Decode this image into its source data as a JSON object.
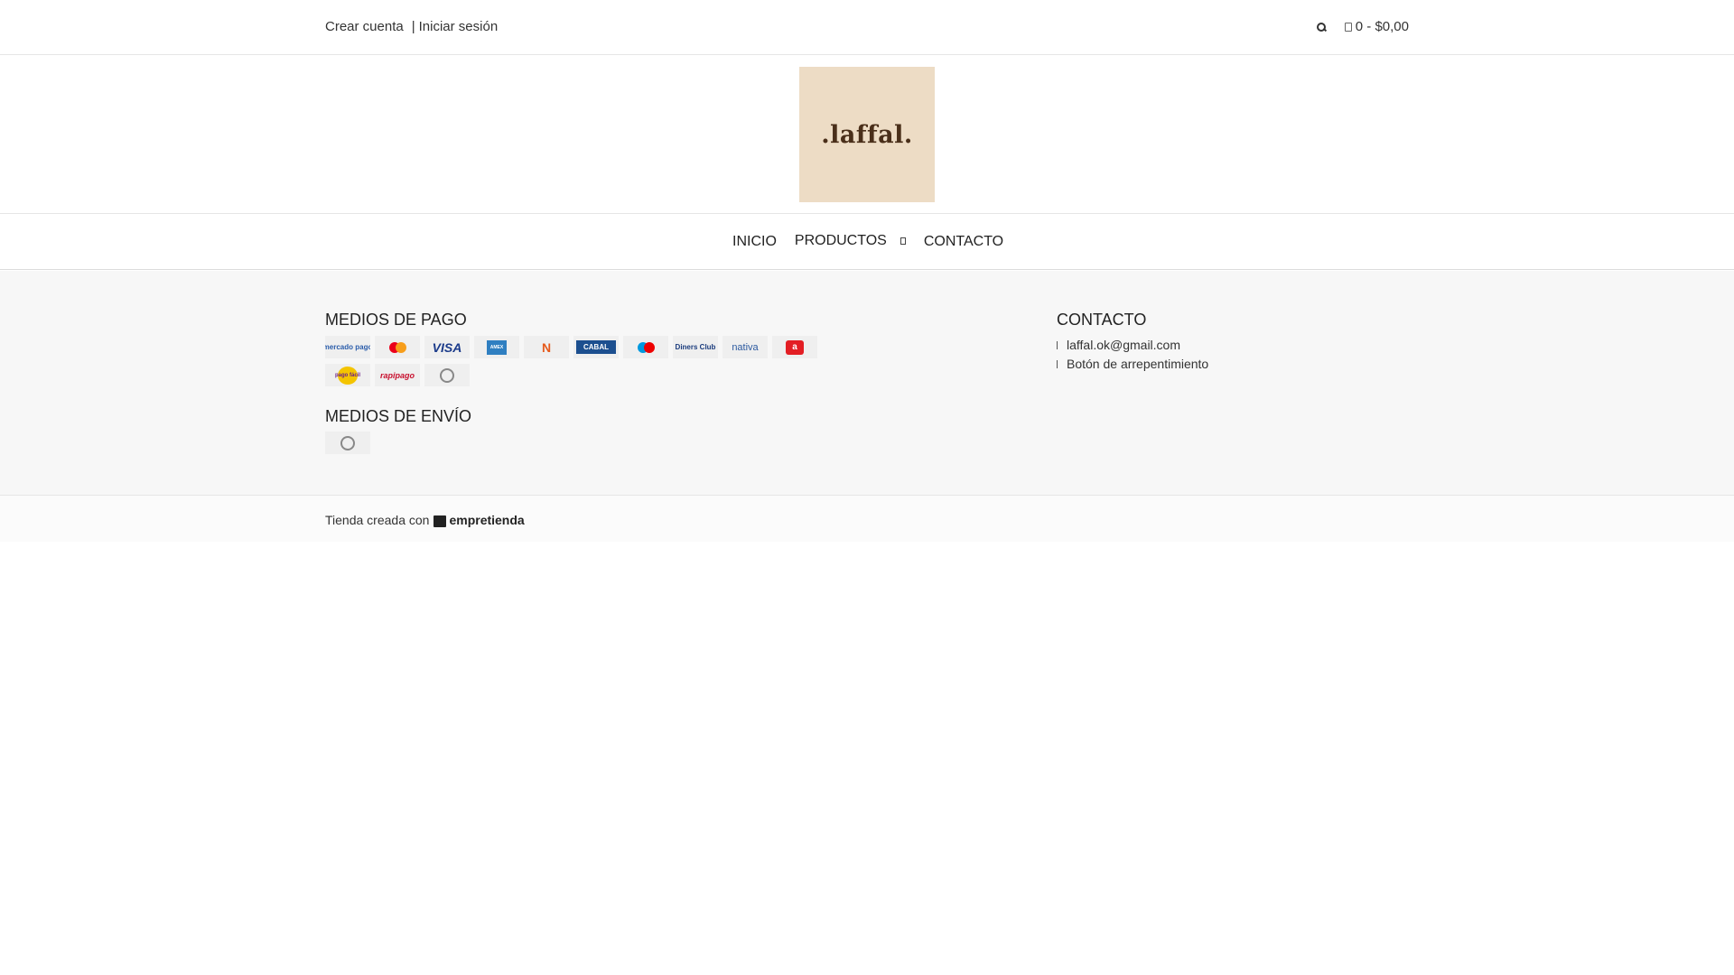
{
  "header": {
    "create_account": "Crear cuenta",
    "separator": "|",
    "login": "Iniciar sesión",
    "search_icon": "search-icon",
    "cart_icon": "cart-icon",
    "cart_summary": "0 - $0,00"
  },
  "logo": {
    "text": ".laffal.",
    "background": "#eddcc5",
    "text_color": "#4a2f1a"
  },
  "nav": {
    "items": [
      {
        "label": "INICIO"
      },
      {
        "label": "PRODUCTOS",
        "icon": "chevron-down-icon"
      },
      {
        "label": "CONTACTO"
      }
    ]
  },
  "footer": {
    "payment_title": "MEDIOS DE PAGO",
    "payment_methods": [
      {
        "name": "mercado pago",
        "label": "mercado pago"
      },
      {
        "name": "mastercard",
        "label": "mastercard"
      },
      {
        "name": "visa",
        "label": "VISA"
      },
      {
        "name": "american express",
        "label": "AMEX"
      },
      {
        "name": "naranja",
        "label": "N"
      },
      {
        "name": "cabal",
        "label": "CABAL"
      },
      {
        "name": "maestro",
        "label": "maestro"
      },
      {
        "name": "diners club",
        "label": "Diners Club"
      },
      {
        "name": "nativa",
        "label": "nativa"
      },
      {
        "name": "argencard",
        "label": "a"
      },
      {
        "name": "pago fácil",
        "label": "pago fácil"
      },
      {
        "name": "rapipago",
        "label": "rapipago"
      },
      {
        "name": "otro",
        "label": ""
      }
    ],
    "shipping_title": "MEDIOS DE ENVÍO",
    "shipping_methods": [
      {
        "name": "otro",
        "label": ""
      }
    ],
    "contact_title": "CONTACTO",
    "contact_items": [
      {
        "icon": "mail-icon",
        "text": "laffal.ok@gmail.com"
      },
      {
        "icon": "undo-icon",
        "text": "Botón de arrepentimiento"
      }
    ]
  },
  "credit": {
    "text": "Tienda creada con",
    "brand": "empretienda"
  }
}
